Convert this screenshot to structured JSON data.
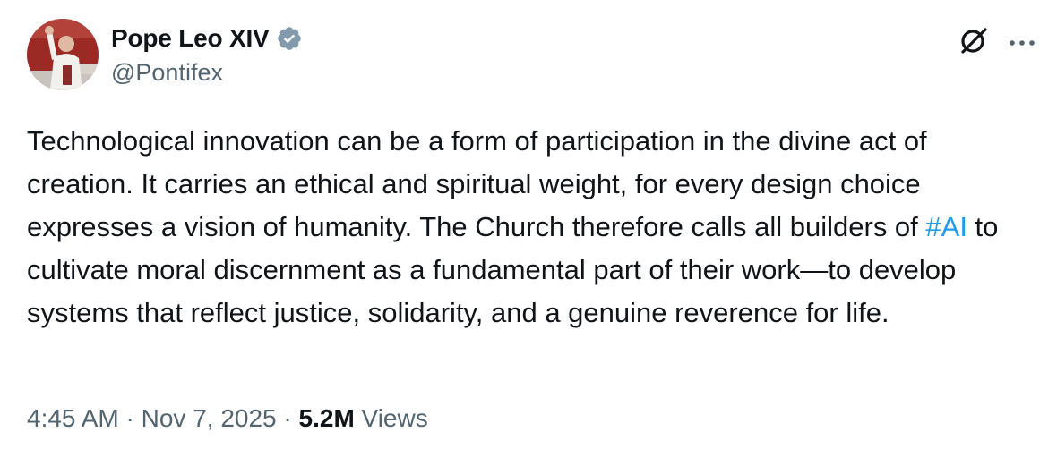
{
  "author": {
    "display_name": "Pope Leo XIV",
    "handle": "@Pontifex",
    "verified_badge_color": "#829aab"
  },
  "icons": {
    "verified": "verified-badge-icon",
    "grok": "grok-icon",
    "more": "more-options-icon"
  },
  "tweet": {
    "text_part1": "Technological innovation can be a form of participation in the divine act of creation. It carries an ethical and spiritual weight, for every design choice expresses a vision of humanity. The Church therefore calls all builders of ",
    "hashtag": "#AI",
    "text_part2": " to cultivate moral discernment as a fundamental part of their work—to develop systems that reflect justice, solidarity, and a genuine reverence for life."
  },
  "meta": {
    "time": "4:45 AM",
    "separator": " · ",
    "date": "Nov 7, 2025",
    "views_count": "5.2M",
    "views_label": " Views"
  },
  "colors": {
    "text": "#0f1419",
    "secondary": "#536471",
    "link": "#1d9bf0"
  }
}
